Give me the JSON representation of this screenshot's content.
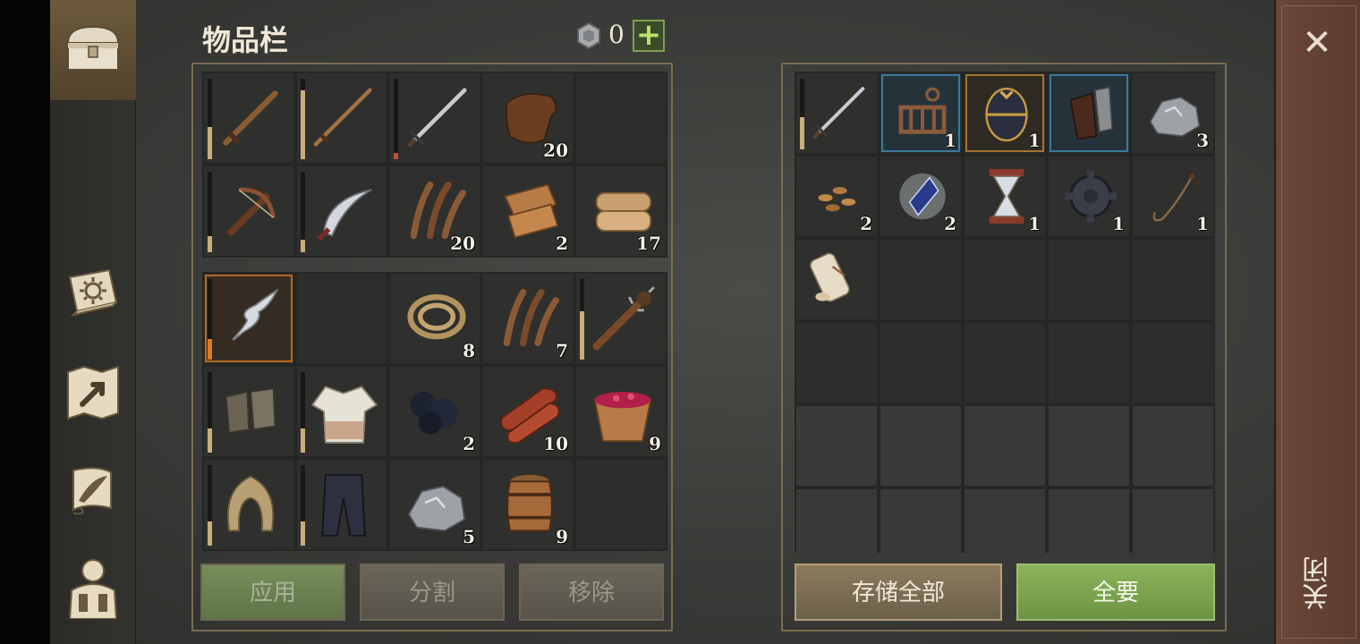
{
  "header": {
    "title": "物品栏",
    "coin_count": "0",
    "plus_label": "+"
  },
  "sidenav": {
    "items": [
      {
        "icon": "chest-icon",
        "active": true
      },
      {
        "icon": "crafting-book-icon",
        "active": false
      },
      {
        "icon": "map-icon",
        "active": false
      },
      {
        "icon": "scroll-quill-icon",
        "active": false
      },
      {
        "icon": "character-equipment-icon",
        "active": false
      }
    ]
  },
  "inventory": {
    "bag_slots": [
      {
        "icon": "wooden-sword-icon",
        "count": "",
        "durability": 0.4
      },
      {
        "icon": "wooden-spear-icon",
        "count": "",
        "durability": 0.85
      },
      {
        "icon": "iron-sword-icon",
        "count": "",
        "durability": 0.08
      },
      {
        "icon": "leather-icon",
        "count": "20"
      },
      {
        "icon": "",
        "count": ""
      },
      {
        "icon": "crossbow-icon",
        "count": "",
        "durability": 0.2
      },
      {
        "icon": "scimitar-icon",
        "count": "",
        "durability": 0.15
      },
      {
        "icon": "plant-fiber-icon",
        "count": "20"
      },
      {
        "icon": "rags-icon",
        "count": "2"
      },
      {
        "icon": "cloth-icon",
        "count": "17"
      }
    ],
    "pocket_slots": [
      {
        "icon": "kris-dagger-icon",
        "count": "",
        "durability": 0.25,
        "selected": true
      },
      {
        "icon": "",
        "count": ""
      },
      {
        "icon": "rope-icon",
        "count": "8"
      },
      {
        "icon": "plant-fiber-icon",
        "count": "7"
      },
      {
        "icon": "spiked-club-icon",
        "count": "",
        "durability": 0.6
      },
      {
        "icon": "gloves-icon",
        "count": "",
        "durability": 0.3
      },
      {
        "icon": "shirt-icon",
        "count": "",
        "durability": 0.3
      },
      {
        "icon": "coal-icon",
        "count": "2"
      },
      {
        "icon": "raw-meat-icon",
        "count": "10"
      },
      {
        "icon": "berry-bowl-icon",
        "count": "9"
      },
      {
        "icon": "hood-icon",
        "count": "",
        "durability": 0.3
      },
      {
        "icon": "pants-icon",
        "count": "",
        "durability": 0.3
      },
      {
        "icon": "iron-ore-icon",
        "count": "5"
      },
      {
        "icon": "barrel-icon",
        "count": "9"
      },
      {
        "icon": "",
        "count": ""
      }
    ],
    "buttons": {
      "apply": "应用",
      "split": "分割",
      "remove": "移除"
    }
  },
  "storage": {
    "slots": [
      {
        "icon": "iron-sword-icon",
        "count": "",
        "durability": 0.45,
        "frame": ""
      },
      {
        "icon": "mechanism-part-icon",
        "count": "1",
        "frame": "blue"
      },
      {
        "icon": "egg-icon",
        "count": "1",
        "frame": "gold"
      },
      {
        "icon": "gauntlet-icon",
        "count": "",
        "frame": "blue"
      },
      {
        "icon": "iron-ore-icon",
        "count": "3",
        "frame": ""
      },
      {
        "icon": "seeds-icon",
        "count": "2",
        "frame": ""
      },
      {
        "icon": "crystal-icon",
        "count": "2",
        "frame": ""
      },
      {
        "icon": "hourglass-icon",
        "count": "1",
        "frame": ""
      },
      {
        "icon": "gear-icon",
        "count": "1",
        "frame": ""
      },
      {
        "icon": "whip-icon",
        "count": "1",
        "frame": ""
      },
      {
        "icon": "scroll-icon",
        "count": "",
        "frame": ""
      }
    ],
    "buttons": {
      "store_all": "存储全部",
      "take_all": "全要"
    }
  },
  "close": {
    "label": "关闭",
    "icon": "close-icon"
  },
  "colors": {
    "accent_green": "#7f9f52",
    "frame": "#7a6c52",
    "selected": "#b06a2a",
    "rare_blue": "#3c7a98",
    "rare_gold": "#a2752f"
  }
}
